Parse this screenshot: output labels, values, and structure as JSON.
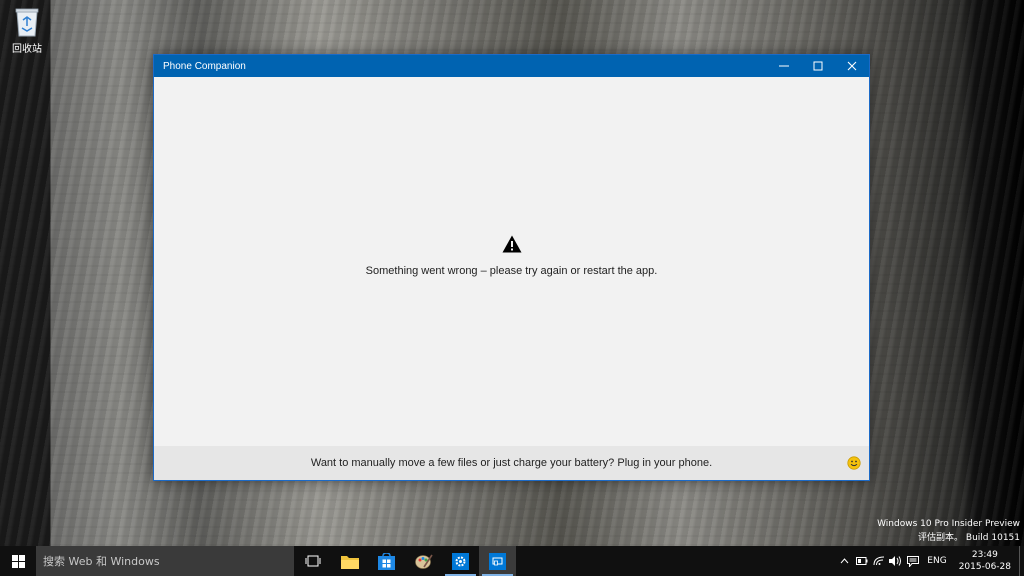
{
  "desktop": {
    "recycle_bin_label": "回收站"
  },
  "window": {
    "title": "Phone Companion",
    "error_message": "Something went wrong – please try again or restart the app.",
    "footer_message": "Want to manually move a few files or just charge your battery? Plug in your phone.",
    "icons": [
      "minimize-icon",
      "maximize-icon",
      "close-icon",
      "warning-icon",
      "smiley-icon"
    ]
  },
  "watermark": {
    "line1": "Windows 10 Pro Insider Preview",
    "line2": "评估副本。 Build 10151"
  },
  "taskbar": {
    "search_placeholder": "搜索 Web 和 Windows",
    "apps": [
      "task-view-icon",
      "file-explorer-icon",
      "store-icon",
      "paint-icon",
      "settings-icon",
      "phone-companion-icon"
    ],
    "tray": {
      "language": "ENG",
      "time": "23:49",
      "date": "2015-06-28"
    }
  },
  "colors": {
    "titlebar": "#0063b1",
    "accent": "#1c6ac7",
    "taskbar": "#101010"
  }
}
